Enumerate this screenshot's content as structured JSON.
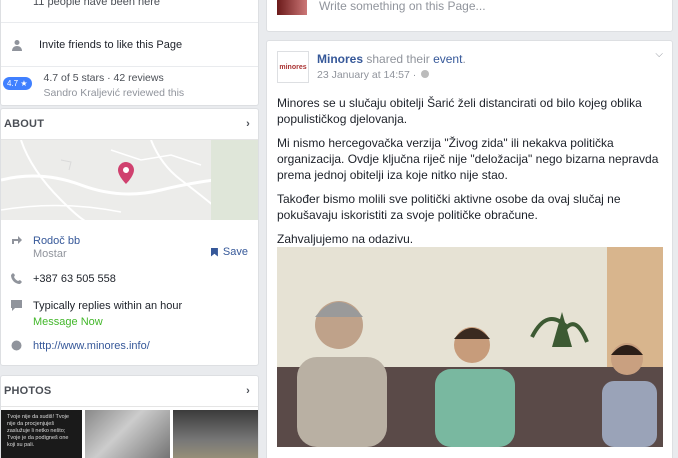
{
  "left": {
    "people_like": "11 people have been here",
    "invite": "Invite friends to like this Page",
    "rating_badge": "4.7 ★",
    "rating_text": "4.7 of 5 stars · 42 reviews",
    "reviewer": "Sandro Kraljević reviewed this",
    "about_title": "ABOUT",
    "address": "Rodoč bb",
    "city": "Mostar",
    "save_label": "Save",
    "phone": "+387 63 505 558",
    "reply_time": "Typically replies within an hour",
    "message_now": "Message Now",
    "website": "http://www.minores.info/",
    "photos_title": "PHOTOS",
    "photo1_text": "Tvoje nije da sudiš! Tvoje nije da procjenjuješ zaslužuje li netko nešto; Tvoje je da podigneš one koji su pali."
  },
  "right": {
    "composer_placeholder": "Write something on this Page...",
    "post_author": "Minores",
    "post_action": "shared their",
    "post_link": "event",
    "post_time": "23 January at 14:57 ·",
    "logo_text": "minores",
    "para1": "Minores se u slučaju obitelji Šarić želi distancirati od bilo kojeg oblika populističkog djelovanja.",
    "para2": "Mi nismo hercegovačka verzija \"Živog zida\" ili nekakva politička organizacija. Ovdje ključna riječ nije \"deložacija\" nego bizarna nepravda prema jednoj obitelji iza koje nitko nije stao.",
    "para3": "Također bismo molili sve politički aktivne osobe da ovaj slučaj ne pokušavaju iskoristiti za svoje političke obračune.",
    "para4": "Zahvaljujemo na odazivu."
  },
  "colors": {
    "link": "#365899",
    "green": "#42b72a",
    "pin": "#d0416f",
    "badge": "#4080ff"
  }
}
